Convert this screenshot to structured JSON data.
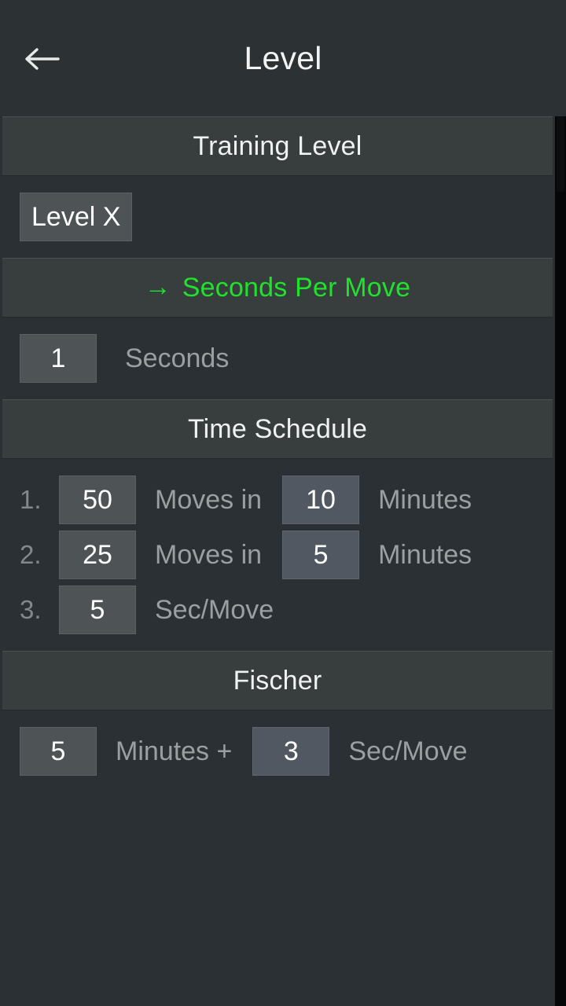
{
  "appbar": {
    "back_icon": "arrow-left-icon",
    "title": "Level"
  },
  "sections": {
    "training_level": {
      "header": "Training Level",
      "level_button": "Level X"
    },
    "seconds_per_move": {
      "header": "Seconds Per Move",
      "arrow": "→",
      "active": true,
      "value": "1",
      "unit_label": "Seconds"
    },
    "time_schedule": {
      "header": "Time Schedule",
      "rows": [
        {
          "index": "1.",
          "moves": "50",
          "moves_label": "Moves in",
          "time": "10",
          "time_label": "Minutes"
        },
        {
          "index": "2.",
          "moves": "25",
          "moves_label": "Moves in",
          "time": "5",
          "time_label": "Minutes"
        },
        {
          "index": "3.",
          "moves": "5",
          "moves_label": "Sec/Move",
          "time": "",
          "time_label": ""
        }
      ]
    },
    "fischer": {
      "header": "Fischer",
      "minutes": "5",
      "minutes_label": "Minutes +",
      "increment": "3",
      "increment_label": "Sec/Move"
    }
  },
  "colors": {
    "accent_green": "#1fe32b",
    "background": "#2a3033",
    "header_bar": "#383d3e",
    "chip": "#4e5456",
    "chip_blue": "#515861",
    "label_text": "#9aa0a1",
    "title_text": "#f2f4f4"
  }
}
